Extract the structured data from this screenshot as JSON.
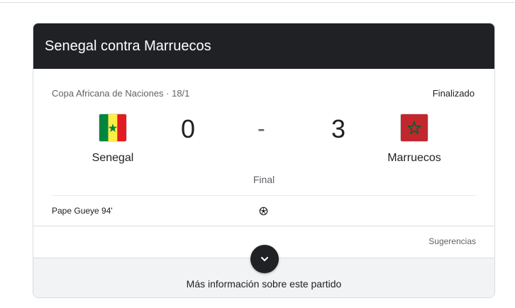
{
  "header": {
    "title": "Senegal contra Marruecos"
  },
  "match": {
    "competition": "Copa Africana de Naciones · 18/1",
    "status": "Finalizado",
    "home": {
      "name": "Senegal",
      "score": "0",
      "flag_icon": "senegal-flag"
    },
    "away": {
      "name": "Marruecos",
      "score": "3",
      "flag_icon": "morocco-flag"
    },
    "separator": "-",
    "result_label": "Final",
    "scorers": {
      "home": "Pape Gueye 94'",
      "goal_icon": "soccer-ball-icon"
    }
  },
  "footer": {
    "suggestions_label": "Sugerencias",
    "more_info_label": "Más información sobre este partido",
    "expand_icon": "chevron-down-icon"
  },
  "colors": {
    "header_bg": "#202124",
    "senegal_green": "#00853F",
    "senegal_yellow": "#FDEF42",
    "senegal_red": "#E31B23",
    "morocco_red": "#C1272D",
    "morocco_green": "#006233"
  }
}
